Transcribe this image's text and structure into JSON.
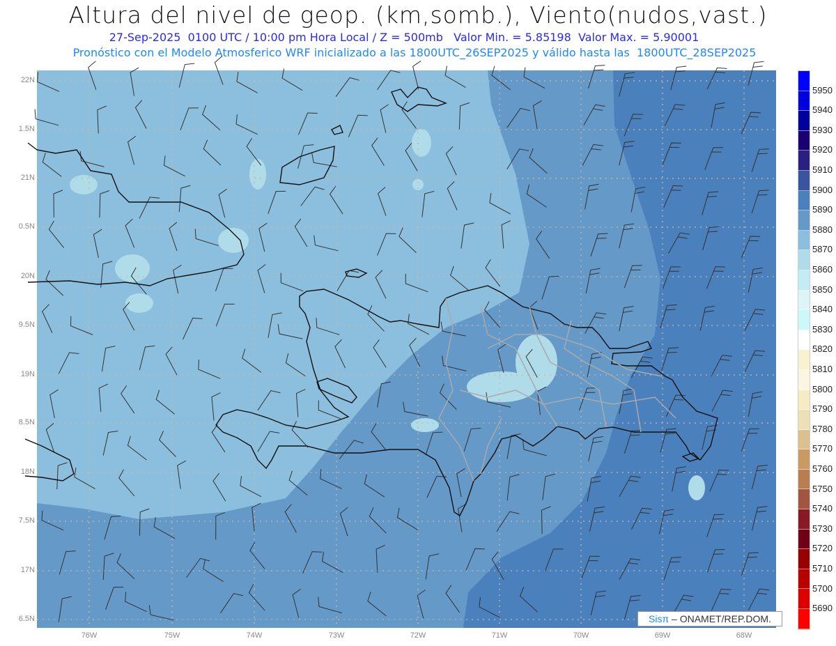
{
  "header": {
    "title": "Altura del nivel de geop. (km,somb.), Viento(nudos,vast.)",
    "line1": "27-Sep-2025  0100 UTC / 10:00 pm Hora Local / Z = 500mb   Valor Min. = 5.85198  Valor Max. = 5.90001",
    "line2": "Pronóstico con el Modelo Atmosferico WRF inicializado a las 1800UTC_26SEP2025 y válido hasta las  1800UTC_28SEP2025"
  },
  "axes": {
    "lat_labels": [
      "22N",
      "1.5N",
      "21N",
      "0.5N",
      "20N",
      "9.5N",
      "19N",
      "8.5N",
      "18N",
      "7.5N",
      "17N",
      "6.5N"
    ],
    "lon_labels": [
      "76W",
      "75W",
      "74W",
      "73W",
      "72W",
      "71W",
      "70W",
      "69W",
      "68W"
    ]
  },
  "colorbar": {
    "labels": [
      "5950",
      "5940",
      "5930",
      "5920",
      "5910",
      "5900",
      "5890",
      "5880",
      "5870",
      "5860",
      "5850",
      "5840",
      "5830",
      "5820",
      "5810",
      "5800",
      "5790",
      "5780",
      "5770",
      "5760",
      "5750",
      "5740",
      "5730",
      "5720",
      "5710",
      "5700",
      "5690"
    ],
    "colors": [
      "#0000ff",
      "#0000dd",
      "#00009a",
      "#1a0070",
      "#2a2080",
      "#3a55a0",
      "#4a80bb",
      "#6599c8",
      "#8cbfdd",
      "#b0dcea",
      "#c4ecf4",
      "#ddf4f8",
      "#ccf8fa",
      "#ffffff",
      "#f8f2d0",
      "#faf6e2",
      "#f5ecc5",
      "#eee0b5",
      "#dcc090",
      "#c89a64",
      "#b87e50",
      "#a05640",
      "#881a26",
      "#6e0018",
      "#960000",
      "#b80000",
      "#dd0000",
      "#ff0000"
    ]
  },
  "map_colors": {
    "light": "#8cbfdd",
    "mid": "#6599c8",
    "dark": "#4a80bb",
    "lighter": "#b0dcea"
  },
  "credit": {
    "brand": "Sisπ",
    "text": " –  ONAMET/REP.DOM."
  }
}
